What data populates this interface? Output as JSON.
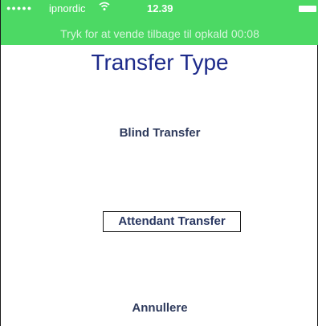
{
  "status_bar": {
    "signal": "●●●●●",
    "carrier": "ipnordic",
    "wifi_icon": "wifi-icon",
    "time": "12.39",
    "battery_icon": "battery-icon"
  },
  "call_banner": {
    "text": "Tryk for at vende tilbage til opkald  00:08"
  },
  "screen": {
    "title": "Transfer Type",
    "options": {
      "blind": "Blind Transfer",
      "attendant": "Attendant Transfer",
      "cancel": "Annullere"
    }
  },
  "colors": {
    "status_bar": "#4cd964",
    "title": "#1d2a8a",
    "option_text": "#2e3a5c"
  }
}
